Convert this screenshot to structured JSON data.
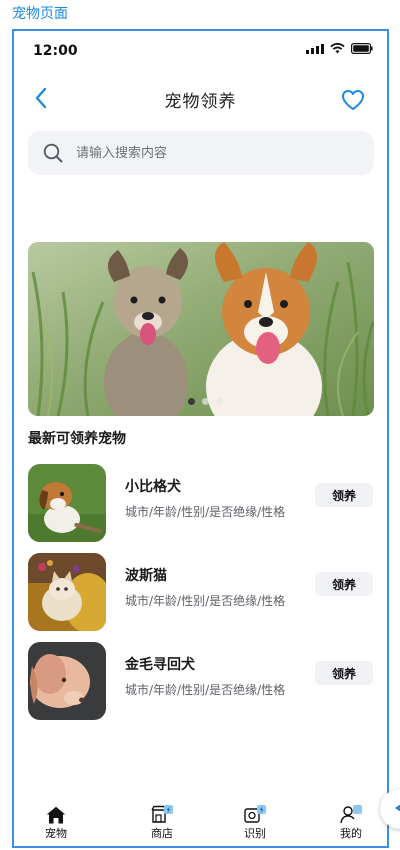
{
  "canvas_label": "宠物页面",
  "status_bar": {
    "time": "12:00"
  },
  "header": {
    "title": "宠物领养"
  },
  "search": {
    "placeholder": "请输入搜索内容"
  },
  "banner": {
    "slide_count": 3,
    "active_index": 0
  },
  "section": {
    "title": "最新可领养宠物"
  },
  "pets": [
    {
      "name": "小比格犬",
      "desc": "城市/年龄/性别/是否绝缘/性格",
      "action": "领养"
    },
    {
      "name": "波斯猫",
      "desc": "城市/年龄/性别/是否绝缘/性格",
      "action": "领养"
    },
    {
      "name": "金毛寻回犬",
      "desc": "城市/年龄/性别/是否绝缘/性格",
      "action": "领养"
    }
  ],
  "bottom_nav": [
    {
      "label": "宠物",
      "icon": "home-icon",
      "active": true
    },
    {
      "label": "商店",
      "icon": "shop-icon",
      "active": false
    },
    {
      "label": "识别",
      "icon": "scan-icon",
      "active": false
    },
    {
      "label": "我的",
      "icon": "profile-icon",
      "active": false
    }
  ],
  "colors": {
    "accent": "#1e88e5",
    "frame_border": "#3d8fe6",
    "search_bg": "#f2f3f7",
    "button_bg": "#f0f1f5"
  }
}
